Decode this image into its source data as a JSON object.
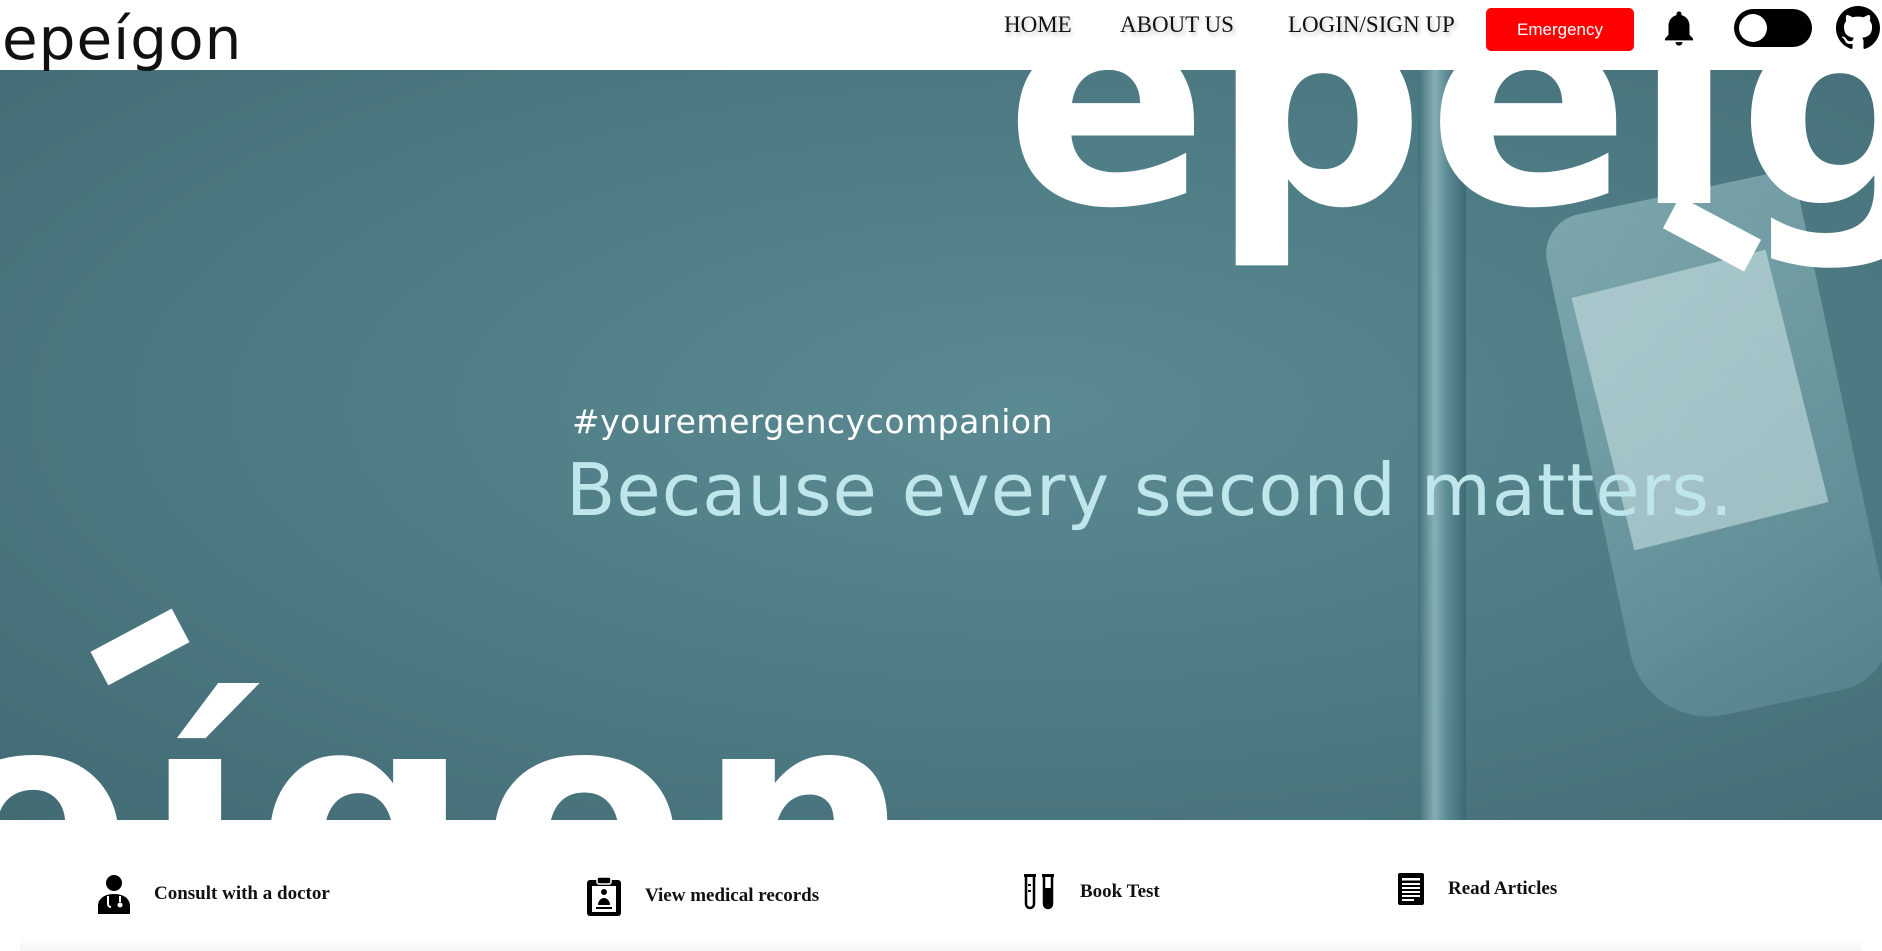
{
  "header": {
    "logo_text": "epeígon",
    "nav": {
      "home": "HOME",
      "about": "ABOUT US",
      "login": "LOGIN/SIGN UP"
    },
    "emergency_label": "Emergency",
    "icons": [
      "bell-icon",
      "theme-toggle",
      "github-icon"
    ]
  },
  "hero": {
    "hashtag": "#youremergencycompanion",
    "tagline": "Because every second matters.",
    "decor_top": "epeígo",
    "decor_bottom": "eígon"
  },
  "features": [
    {
      "label": "Consult with a doctor",
      "icon": "doctor-icon"
    },
    {
      "label": "View medical records",
      "icon": "clipboard-icon"
    },
    {
      "label": "Book Test",
      "icon": "test-tubes-icon"
    },
    {
      "label": "Read Articles",
      "icon": "article-icon"
    }
  ],
  "colors": {
    "emergency": "#ff0000",
    "hero_bg": "#4f7d86",
    "tagline": "#bfe6ea"
  }
}
